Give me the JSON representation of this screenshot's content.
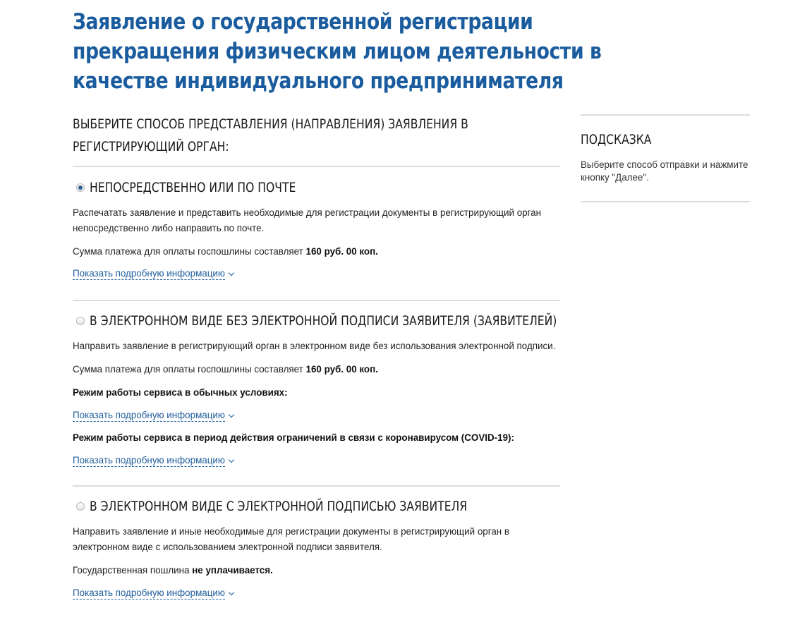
{
  "page": {
    "title": "Заявление о государственной регистрации прекращения физическим лицом деятельности в качестве индивидуального предпринимателя"
  },
  "main": {
    "heading": "ВЫБЕРИТЕ СПОСОБ ПРЕДСТАВЛЕНИЯ (НАПРАВЛЕНИЯ) ЗАЯВЛЕНИЯ В РЕГИСТРИРУЮЩИЙ ОРГАН:",
    "more_label": "Показать подробную информацию",
    "options": [
      {
        "title": "НЕПОСРЕДСТВЕННО ИЛИ ПО ПОЧТЕ",
        "selected": true,
        "description": "Распечатать заявление и представить необходимые для регистрации документы в регистрирующий орган непосредственно либо направить по почте.",
        "fee_text": "Сумма платежа для оплаты госпошлины составляет",
        "fee_value": "160 руб. 00 коп."
      },
      {
        "title": "В ЭЛЕКТРОННОМ ВИДЕ БЕЗ ЭЛЕКТРОННОЙ ПОДПИСИ ЗАЯВИТЕЛЯ (ЗАЯВИТЕЛЕЙ)",
        "selected": false,
        "description": "Направить заявление в регистрирующий орган в электронном виде без использования электронной подписи.",
        "fee_text": "Сумма платежа для оплаты госпошлины составляет",
        "fee_value": "160 руб. 00 коп.",
        "mode_normal": "Режим работы сервиса в обычных условиях:",
        "mode_covid": "Режим работы сервиса в период действия ограничений в связи с коронавирусом (COVID-19):"
      },
      {
        "title": "В ЭЛЕКТРОННОМ ВИДЕ С ЭЛЕКТРОННОЙ ПОДПИСЬЮ ЗАЯВИТЕЛЯ",
        "selected": false,
        "description": "Направить заявление и иные необходимые для регистрации документы в регистрирующий орган в электронном виде с использованием электронной подписи заявителя.",
        "fee_text": "Государственная пошлина",
        "fee_value": "не уплачивается."
      }
    ]
  },
  "sidebar": {
    "title": "ПОДСКАЗКА",
    "text": "Выберите способ отправки и нажмите кнопку \"Далее\"."
  },
  "colors": {
    "title": "#1a5c9e",
    "link": "#1f5e9c",
    "radio_dot": "#2a5f93",
    "divider": "#dcdcdc"
  },
  "icons": {
    "chevron": "chevron-down-icon",
    "radio": "radio-button"
  }
}
